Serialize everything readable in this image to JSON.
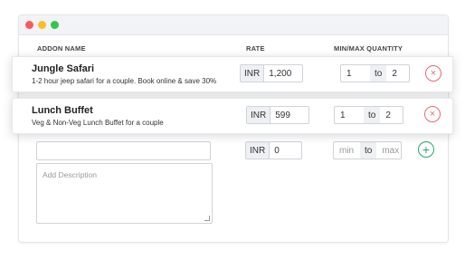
{
  "window": {
    "controls": [
      "close",
      "minimize",
      "maximize"
    ],
    "colors": {
      "close": "#fc5b57",
      "minimize": "#fdbc2e",
      "maximize": "#33c748"
    }
  },
  "table": {
    "headers": {
      "name": "ADDON NAME",
      "rate": "RATE",
      "quantity": "MIN/MAX QUANTITY"
    }
  },
  "addons": [
    {
      "title": "Jungle Safari",
      "description": "1-2 hour jeep safari for a couple. Book online & save 30%",
      "currency": "INR",
      "rate": "1,200",
      "min": "1",
      "to_label": "to",
      "max": "2",
      "action_icon": "close-circle-icon"
    },
    {
      "title": "Lunch Buffet",
      "description": "Veg & Non-Veg Lunch Buffet for a couple",
      "currency": "INR",
      "rate": "599",
      "min": "1",
      "to_label": "to",
      "max": "2",
      "action_icon": "close-circle-icon"
    }
  ],
  "new_addon": {
    "name_value": "",
    "description_placeholder": "Add Description",
    "currency": "INR",
    "rate": "0",
    "min_placeholder": "min",
    "to_label": "to",
    "max_placeholder": "max",
    "action_icon": "plus-circle-icon"
  },
  "icons": {
    "remove": "×",
    "add": "+"
  },
  "accent_colors": {
    "remove": "#e46a72",
    "add": "#27a86b"
  }
}
